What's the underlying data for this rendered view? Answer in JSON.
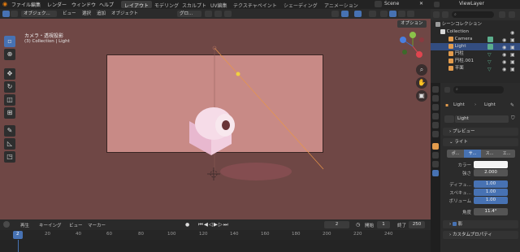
{
  "menubar": {
    "items": [
      "ファイル",
      "編集",
      "レンダー",
      "ウィンドウ",
      "ヘルプ"
    ],
    "workspaces": [
      "レイアウト",
      "モデリング",
      "スカルプト",
      "UV編集",
      "テクスチャペイント",
      "シェーディング",
      "アニメーション"
    ],
    "active_workspace": "レイアウト",
    "scene": "Scene",
    "view_layer": "ViewLayer"
  },
  "viewport_header": {
    "mode": "オブジェク...",
    "menus": [
      "ビュー",
      "選択",
      "追加",
      "オブジェクト"
    ],
    "transform": "グロ...",
    "options": "オプション"
  },
  "viewport": {
    "overlay_title": "カメラ・透視投影",
    "overlay_subtitle": "(3) Collection | Light",
    "gizmo_axes": [
      "Y",
      "X",
      "Z"
    ]
  },
  "toolbar": {
    "tools": [
      "select",
      "cursor",
      "move",
      "rotate",
      "scale",
      "transform",
      "annotate",
      "measure",
      "add-cube"
    ]
  },
  "timeline": {
    "menus": [
      "再生",
      "キーイング",
      "ビュー",
      "マーカー"
    ],
    "current_frame": "2",
    "start_label": "開始",
    "start": "1",
    "end_label": "終了",
    "end": "250",
    "ruler": [
      "2",
      "20",
      "40",
      "60",
      "80",
      "100",
      "120",
      "140",
      "160",
      "180",
      "200",
      "220",
      "240"
    ]
  },
  "outliner": {
    "root": "シーンコレクション",
    "items": [
      {
        "name": "Collection",
        "color": "#d8d8d8",
        "selected": false,
        "indent": 1
      },
      {
        "name": "Camera",
        "color": "#e39c4d",
        "selected": false,
        "indent": 2
      },
      {
        "name": "Light",
        "color": "#e39c4d",
        "selected": true,
        "indent": 2
      },
      {
        "name": "円柱",
        "color": "#e39c4d",
        "selected": false,
        "indent": 2
      },
      {
        "name": "円柱.001",
        "color": "#e39c4d",
        "selected": false,
        "indent": 2
      },
      {
        "name": "平面",
        "color": "#e39c4d",
        "selected": false,
        "indent": 2
      }
    ]
  },
  "properties": {
    "breadcrumb_object": "Light",
    "breadcrumb_data": "Light",
    "data_name": "Light",
    "sections": {
      "preview": "プレビュー",
      "light": "ライト",
      "shadow": "影",
      "custom": "カスタムプロパティ"
    },
    "light_types": [
      "ポ...",
      "サ...",
      "ス...",
      "エ..."
    ],
    "fields": {
      "color_label": "カラー",
      "strength_label": "強さ",
      "strength": "2.000",
      "diffuse_label": "ディフュ...",
      "diffuse": "1.00",
      "specular_label": "スペキュ...",
      "specular": "1.00",
      "volume_label": "ボリューム",
      "volume": "1.00",
      "radius_label": "角度",
      "radius": "11.4°"
    }
  }
}
